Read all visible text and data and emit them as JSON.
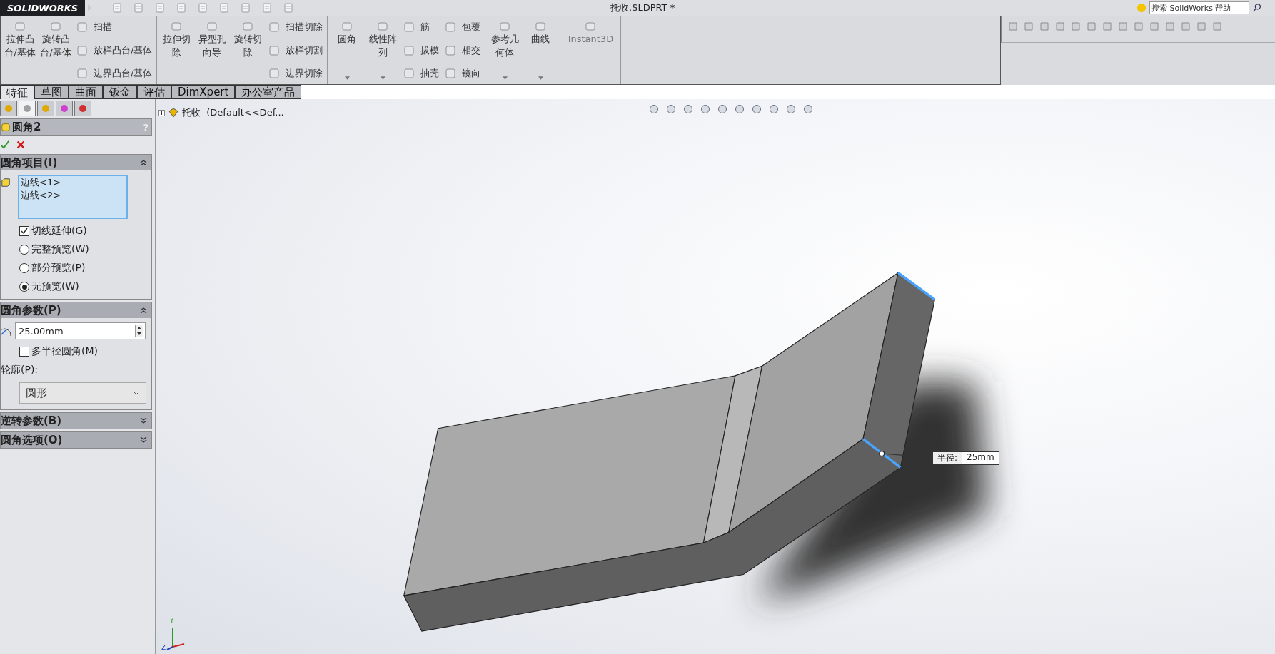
{
  "title_bar": {
    "logo": "SOLIDWORKS",
    "document_title": "托收.SLDPRT *",
    "search": {
      "placeholder": "搜索 SolidWorks 帮助"
    }
  },
  "ribbon": {
    "groups": [
      {
        "large": [
          {
            "label": "拉伸凸台/基体",
            "dropdown": false,
            "disabled": false
          },
          {
            "label": "旋转凸台/基体",
            "dropdown": false,
            "disabled": false
          }
        ],
        "small_columns": [
          [
            "扫描",
            "放样凸台/基体",
            "边界凸台/基体"
          ]
        ]
      },
      {
        "large": [
          {
            "label": "拉伸切除",
            "dropdown": false,
            "disabled": false
          },
          {
            "label": "异型孔向导",
            "dropdown": false,
            "disabled": false
          },
          {
            "label": "旋转切除",
            "dropdown": false,
            "disabled": false
          }
        ],
        "small_columns": [
          [
            "扫描切除",
            "放样切割",
            "边界切除"
          ]
        ]
      },
      {
        "large": [
          {
            "label": "圆角",
            "dropdown": true,
            "disabled": false
          },
          {
            "label": "线性阵列",
            "dropdown": true,
            "disabled": false
          }
        ],
        "small_columns": [
          [
            "筋",
            "拔模",
            "抽壳"
          ],
          [
            "包覆",
            "相交",
            "镜向"
          ]
        ]
      },
      {
        "large": [
          {
            "label": "参考几何体",
            "dropdown": true,
            "disabled": false
          },
          {
            "label": "曲线",
            "dropdown": true,
            "disabled": false
          }
        ]
      },
      {
        "large": [
          {
            "label": "Instant3D",
            "dropdown": false,
            "disabled": true
          }
        ]
      }
    ]
  },
  "tabs": [
    {
      "label": "特征",
      "selected": true
    },
    {
      "label": "草图",
      "selected": false
    },
    {
      "label": "曲面",
      "selected": false
    },
    {
      "label": "钣金",
      "selected": false
    },
    {
      "label": "评估",
      "selected": false
    },
    {
      "label": "DimXpert",
      "selected": false
    },
    {
      "label": "办公室产品",
      "selected": false
    }
  ],
  "panel_tabs": [
    {
      "selected": false
    },
    {
      "selected": true
    },
    {
      "selected": false
    },
    {
      "selected": false
    },
    {
      "selected": false
    }
  ],
  "property_manager": {
    "title": "圆角2",
    "help": "?",
    "sections": [
      {
        "title": "圆角项目(I)",
        "expanded": true,
        "kind": "items"
      },
      {
        "title": "圆角参数(P)",
        "expanded": true,
        "kind": "params"
      },
      {
        "title": "逆转参数(B)",
        "expanded": false,
        "kind": "empty"
      },
      {
        "title": "圆角选项(O)",
        "expanded": false,
        "kind": "empty"
      }
    ],
    "items": [
      "边线<1>",
      "边线<2>"
    ],
    "tangent_propagation": {
      "label": "切线延伸(G)",
      "checked": true
    },
    "preview_options": [
      {
        "label": "完整预览(W)",
        "selected": false
      },
      {
        "label": "部分预览(P)",
        "selected": false
      },
      {
        "label": "无预览(W)",
        "selected": true
      }
    ],
    "radius": {
      "value": "25.00mm"
    },
    "multiple_radius": {
      "label": "多半径圆角(M)",
      "checked": false
    },
    "profile": {
      "label": "轮廓(P):",
      "value": "圆形"
    }
  },
  "feature_tree": {
    "root": "托收  (Default<<Def..."
  },
  "viewport": {
    "dimension": {
      "label": "半径:",
      "value": "25mm"
    },
    "triad": {
      "y": "Y",
      "z": "Z"
    }
  }
}
